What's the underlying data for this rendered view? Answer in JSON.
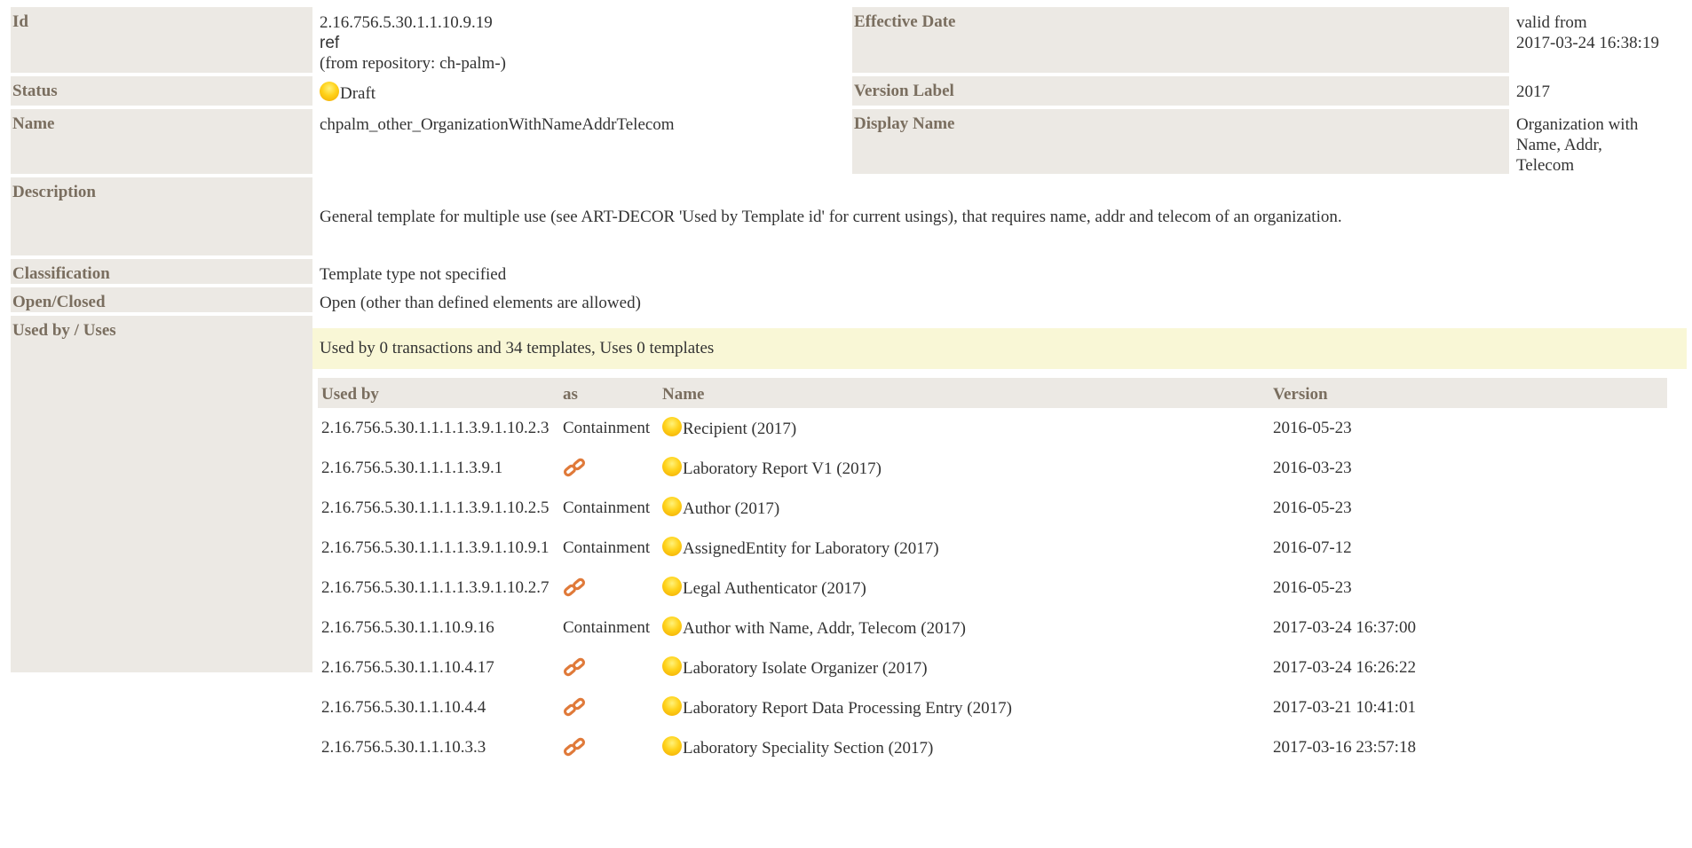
{
  "header": {
    "id_label": "Id",
    "id_lines": [
      "2.16.756.5.30.1.1.10.9.19",
      "ref",
      "(from repository: ch-palm-)"
    ],
    "effective_label": "Effective Date",
    "effective_lines": [
      "valid from",
      "2017-03-24 16:38:19"
    ],
    "status_label": "Status",
    "status_value": "Draft",
    "version_label": "Version Label",
    "version_value": "2017",
    "name_label": "Name",
    "name_value": "chpalm_other_OrganizationWithNameAddrTelecom",
    "display_label": "Display Name",
    "display_lines": [
      "Organization with",
      "Name, Addr,",
      "Telecom"
    ],
    "description_label": "Description",
    "description_value": "General template for multiple use (see ART-DECOR 'Used by Template id' for current usings), that requires name, addr and telecom of an organization.",
    "classification_label": "Classification",
    "classification_value": "Template type not specified",
    "openclosed_label": "Open/Closed",
    "openclosed_value": "Open (other than defined elements are allowed)",
    "usedby_label": "Used by / Uses"
  },
  "usage": {
    "summary": "Used by 0 transactions and 34 templates, Uses 0 templates",
    "columns": [
      "Used by",
      "as",
      "Name",
      "Version"
    ],
    "rows": [
      {
        "id": "2.16.756.5.30.1.1.1.1.3.9.1.10.2.3",
        "as": "Containment",
        "name": "Recipient (2017)",
        "version": "2016-05-23"
      },
      {
        "id": "2.16.756.5.30.1.1.1.1.3.9.1",
        "as": "link",
        "name": "Laboratory Report V1 (2017)",
        "version": "2016-03-23"
      },
      {
        "id": "2.16.756.5.30.1.1.1.1.3.9.1.10.2.5",
        "as": "Containment",
        "name": "Author (2017)",
        "version": "2016-05-23"
      },
      {
        "id": "2.16.756.5.30.1.1.1.1.3.9.1.10.9.1",
        "as": "Containment",
        "name": "AssignedEntity for Laboratory (2017)",
        "version": "2016-07-12"
      },
      {
        "id": "2.16.756.5.30.1.1.1.1.3.9.1.10.2.7",
        "as": "link",
        "name": "Legal Authenticator (2017)",
        "version": "2016-05-23"
      },
      {
        "id": "2.16.756.5.30.1.1.10.9.16",
        "as": "Containment",
        "name": "Author with Name, Addr, Telecom (2017)",
        "version": "2017-03-24 16:37:00"
      },
      {
        "id": "2.16.756.5.30.1.1.10.4.17",
        "as": "link",
        "name": "Laboratory Isolate Organizer (2017)",
        "version": "2017-03-24 16:26:22"
      },
      {
        "id": "2.16.756.5.30.1.1.10.4.4",
        "as": "link",
        "name": "Laboratory Report Data Processing Entry (2017)",
        "version": "2017-03-21 10:41:01"
      },
      {
        "id": "2.16.756.5.30.1.1.10.3.3",
        "as": "link",
        "name": "Laboratory Speciality Section (2017)",
        "version": "2017-03-16 23:57:18"
      }
    ]
  },
  "icons": {
    "status": "draft-status-dot-icon",
    "link": "chain-link-icon"
  },
  "colors": {
    "label_bg": "#ece9e4",
    "label_text": "#7a6e5f",
    "summary_bg": "#f9f7d6",
    "status_dot": "#ffd21a",
    "link_icon": "#e07a3a"
  }
}
